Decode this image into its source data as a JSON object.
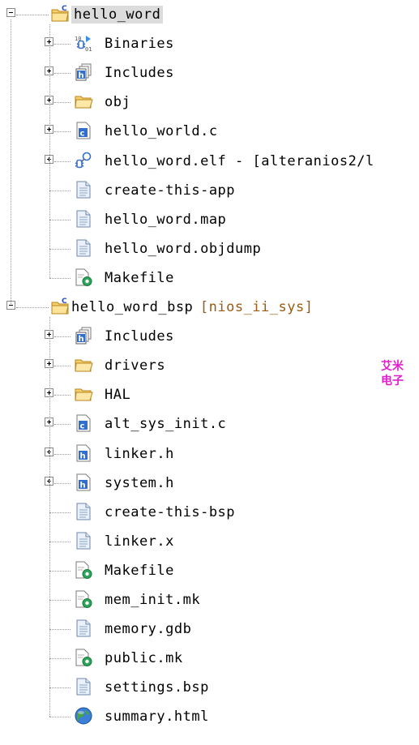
{
  "tree": {
    "projects": [
      {
        "name": "hello_word",
        "suffix": "",
        "children": [
          {
            "name": "Binaries",
            "icon": "binaries-icon",
            "expandable": true
          },
          {
            "name": "Includes",
            "icon": "includes-icon",
            "expandable": true
          },
          {
            "name": "obj",
            "icon": "folder-icon",
            "expandable": true
          },
          {
            "name": "hello_world.c",
            "icon": "c-source-file-icon",
            "expandable": true
          },
          {
            "name": "hello_word.elf - [alteranios2/l",
            "icon": "elf-binary-icon",
            "expandable": true
          },
          {
            "name": "create-this-app",
            "icon": "text-file-icon",
            "expandable": false
          },
          {
            "name": "hello_word.map",
            "icon": "text-file-icon",
            "expandable": false
          },
          {
            "name": "hello_word.objdump",
            "icon": "text-file-icon",
            "expandable": false
          },
          {
            "name": "Makefile",
            "icon": "makefile-icon",
            "expandable": false
          }
        ]
      },
      {
        "name": "hello_word_bsp",
        "suffix": "[nios_ii_sys]",
        "children": [
          {
            "name": "Includes",
            "icon": "includes-icon",
            "expandable": true
          },
          {
            "name": "drivers",
            "icon": "folder-icon",
            "expandable": true
          },
          {
            "name": "HAL",
            "icon": "folder-icon",
            "expandable": true
          },
          {
            "name": "alt_sys_init.c",
            "icon": "c-source-file-icon",
            "expandable": true
          },
          {
            "name": "linker.h",
            "icon": "header-file-icon",
            "expandable": true
          },
          {
            "name": "system.h",
            "icon": "header-file-icon",
            "expandable": true
          },
          {
            "name": "create-this-bsp",
            "icon": "text-file-icon",
            "expandable": false
          },
          {
            "name": "linker.x",
            "icon": "text-file-icon",
            "expandable": false
          },
          {
            "name": "Makefile",
            "icon": "makefile-icon",
            "expandable": false
          },
          {
            "name": "mem_init.mk",
            "icon": "makefile-icon",
            "expandable": false
          },
          {
            "name": "memory.gdb",
            "icon": "text-file-icon",
            "expandable": false
          },
          {
            "name": "public.mk",
            "icon": "makefile-icon",
            "expandable": false
          },
          {
            "name": "settings.bsp",
            "icon": "text-file-icon",
            "expandable": false
          },
          {
            "name": "summary.html",
            "icon": "html-globe-icon",
            "expandable": false
          }
        ]
      }
    ]
  },
  "watermark": {
    "line1": "艾米",
    "line2": "电子"
  },
  "colors": {
    "selection": "#dcdcdc",
    "suffix": "#9a5a12",
    "watermark": "#e020c8"
  }
}
